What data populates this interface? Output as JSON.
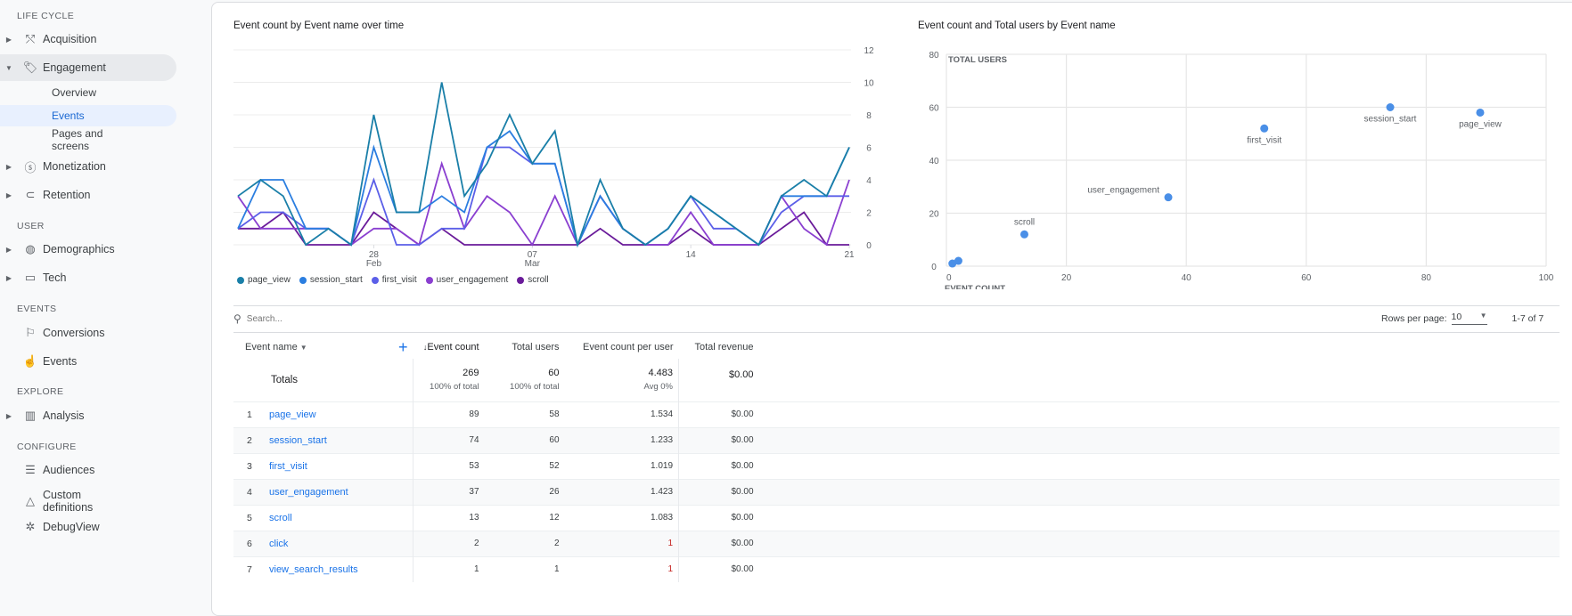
{
  "sidebar": {
    "sections": [
      {
        "title": "LIFE CYCLE"
      },
      {
        "title": "USER"
      },
      {
        "title": "EVENTS"
      },
      {
        "title": "EXPLORE"
      },
      {
        "title": "CONFIGURE"
      }
    ],
    "items": {
      "acquisition": "Acquisition",
      "engagement": "Engagement",
      "overview": "Overview",
      "events_sub": "Events",
      "pages_screens": "Pages and screens",
      "monetization": "Monetization",
      "retention": "Retention",
      "demographics": "Demographics",
      "tech": "Tech",
      "conversions": "Conversions",
      "events": "Events",
      "analysis": "Analysis",
      "audiences": "Audiences",
      "custom_definitions": "Custom definitions",
      "debugview": "DebugView"
    }
  },
  "colors": {
    "page_view": "#1a7fa8",
    "session_start": "#2b7ee0",
    "first_visit": "#5b5fe8",
    "user_engagement": "#8a3fd0",
    "scroll": "#6a1b9a",
    "scatter_point": "#4a8fe7"
  },
  "chart_data": [
    {
      "type": "line",
      "title": "Event count by Event name over time",
      "x": [
        "Feb 22",
        "Feb 23",
        "Feb 24",
        "Feb 25",
        "Feb 26",
        "Feb 27",
        "Feb 28",
        "Mar 01",
        "Mar 02",
        "Mar 03",
        "Mar 04",
        "Mar 05",
        "Mar 06",
        "Mar 07",
        "Mar 08",
        "Mar 09",
        "Mar 10",
        "Mar 11",
        "Mar 12",
        "Mar 13",
        "Mar 14",
        "Mar 15",
        "Mar 16",
        "Mar 17",
        "Mar 18",
        "Mar 19",
        "Mar 20",
        "Mar 21"
      ],
      "x_ticks": [
        {
          "label": "28",
          "sub": "Feb",
          "index": 6
        },
        {
          "label": "07",
          "sub": "Mar",
          "index": 13
        },
        {
          "label": "14",
          "sub": "",
          "index": 20
        },
        {
          "label": "21",
          "sub": "",
          "index": 27
        }
      ],
      "y_ticks": [
        0,
        2,
        4,
        6,
        8,
        10,
        12
      ],
      "ylim": [
        0,
        12
      ],
      "grid": true,
      "legend_position": "bottom-left",
      "series": [
        {
          "name": "page_view",
          "values": [
            3,
            4,
            3,
            0,
            1,
            0,
            8,
            2,
            2,
            10,
            3,
            5,
            8,
            5,
            7,
            0,
            4,
            1,
            0,
            1,
            3,
            2,
            1,
            0,
            3,
            4,
            3,
            6
          ]
        },
        {
          "name": "session_start",
          "values": [
            1,
            4,
            4,
            1,
            1,
            0,
            6,
            2,
            2,
            3,
            2,
            6,
            7,
            5,
            5,
            0,
            3,
            1,
            0,
            1,
            3,
            2,
            1,
            0,
            3,
            3,
            3,
            6
          ]
        },
        {
          "name": "first_visit",
          "values": [
            1,
            2,
            2,
            1,
            1,
            0,
            4,
            0,
            0,
            1,
            1,
            6,
            6,
            5,
            5,
            0,
            3,
            1,
            0,
            1,
            3,
            1,
            1,
            0,
            2,
            3,
            3,
            3
          ]
        },
        {
          "name": "user_engagement",
          "values": [
            3,
            1,
            1,
            1,
            1,
            0,
            1,
            1,
            0,
            5,
            1,
            3,
            2,
            0,
            3,
            0,
            3,
            1,
            0,
            0,
            2,
            0,
            0,
            0,
            3,
            1,
            0,
            4
          ]
        },
        {
          "name": "scroll",
          "values": [
            1,
            1,
            2,
            0,
            0,
            0,
            2,
            1,
            0,
            1,
            0,
            0,
            0,
            0,
            0,
            0,
            1,
            0,
            0,
            0,
            1,
            0,
            0,
            0,
            1,
            2,
            0,
            0
          ]
        }
      ]
    },
    {
      "type": "scatter",
      "title": "Event count and Total users by Event name",
      "xlabel": "EVENT COUNT",
      "ylabel": "TOTAL USERS",
      "xlim": [
        0,
        100
      ],
      "ylim": [
        0,
        80
      ],
      "x_ticks": [
        0,
        20,
        40,
        60,
        80,
        100
      ],
      "y_ticks": [
        0,
        20,
        40,
        60,
        80
      ],
      "grid": true,
      "points": [
        {
          "label": "page_view",
          "x": 89,
          "y": 58,
          "label_pos": "below"
        },
        {
          "label": "session_start",
          "x": 74,
          "y": 60,
          "label_pos": "below"
        },
        {
          "label": "first_visit",
          "x": 53,
          "y": 52,
          "label_pos": "below"
        },
        {
          "label": "user_engagement",
          "x": 37,
          "y": 26,
          "label_pos": "left-above"
        },
        {
          "label": "scroll",
          "x": 13,
          "y": 12,
          "label_pos": "above"
        },
        {
          "label": "",
          "x": 2,
          "y": 2,
          "label_pos": "none"
        },
        {
          "label": "",
          "x": 1,
          "y": 1,
          "label_pos": "none"
        }
      ]
    }
  ],
  "table": {
    "search_placeholder": "Search...",
    "rows_per_page_label": "Rows per page:",
    "rows_per_page_value": "10",
    "range": "1-7 of 7",
    "headers": {
      "event_name": "Event name",
      "event_count": "Event count",
      "total_users": "Total users",
      "event_count_per_user": "Event count per user",
      "total_revenue": "Total revenue"
    },
    "totals": {
      "label": "Totals",
      "event_count": "269",
      "event_count_sub": "100% of total",
      "total_users": "60",
      "total_users_sub": "100% of total",
      "per_user": "4.483",
      "per_user_sub": "Avg 0%",
      "revenue": "$0.00"
    },
    "rows": [
      {
        "idx": "1",
        "name": "page_view",
        "count": "89",
        "users": "58",
        "per_user": "1.534",
        "revenue": "$0.00"
      },
      {
        "idx": "2",
        "name": "session_start",
        "count": "74",
        "users": "60",
        "per_user": "1.233",
        "revenue": "$0.00"
      },
      {
        "idx": "3",
        "name": "first_visit",
        "count": "53",
        "users": "52",
        "per_user": "1.019",
        "revenue": "$0.00"
      },
      {
        "idx": "4",
        "name": "user_engagement",
        "count": "37",
        "users": "26",
        "per_user": "1.423",
        "revenue": "$0.00"
      },
      {
        "idx": "5",
        "name": "scroll",
        "count": "13",
        "users": "12",
        "per_user": "1.083",
        "revenue": "$0.00"
      },
      {
        "idx": "6",
        "name": "click",
        "count": "2",
        "users": "2",
        "per_user": "1",
        "revenue": "$0.00"
      },
      {
        "idx": "7",
        "name": "view_search_results",
        "count": "1",
        "users": "1",
        "per_user": "1",
        "revenue": "$0.00"
      }
    ]
  }
}
